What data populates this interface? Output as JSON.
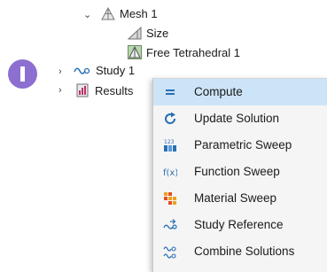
{
  "tree": {
    "mesh": "Mesh 1",
    "size": "Size",
    "free_tet": "Free Tetrahedral 1",
    "study": "Study 1",
    "results": "Results"
  },
  "menu": {
    "items": [
      {
        "label": "Compute",
        "icon": "compute-icon"
      },
      {
        "label": "Update Solution",
        "icon": "update-solution-icon"
      },
      {
        "label": "Parametric Sweep",
        "icon": "parametric-sweep-icon"
      },
      {
        "label": "Function Sweep",
        "icon": "function-sweep-icon"
      },
      {
        "label": "Material Sweep",
        "icon": "material-sweep-icon"
      },
      {
        "label": "Study Reference",
        "icon": "study-reference-icon"
      },
      {
        "label": "Combine Solutions",
        "icon": "combine-solutions-icon"
      }
    ]
  },
  "colors": {
    "selected_bg": "#cce4f7",
    "accent": "#8c6fd0",
    "icon_blue": "#2a6fb5",
    "orange": "#f0a020"
  }
}
